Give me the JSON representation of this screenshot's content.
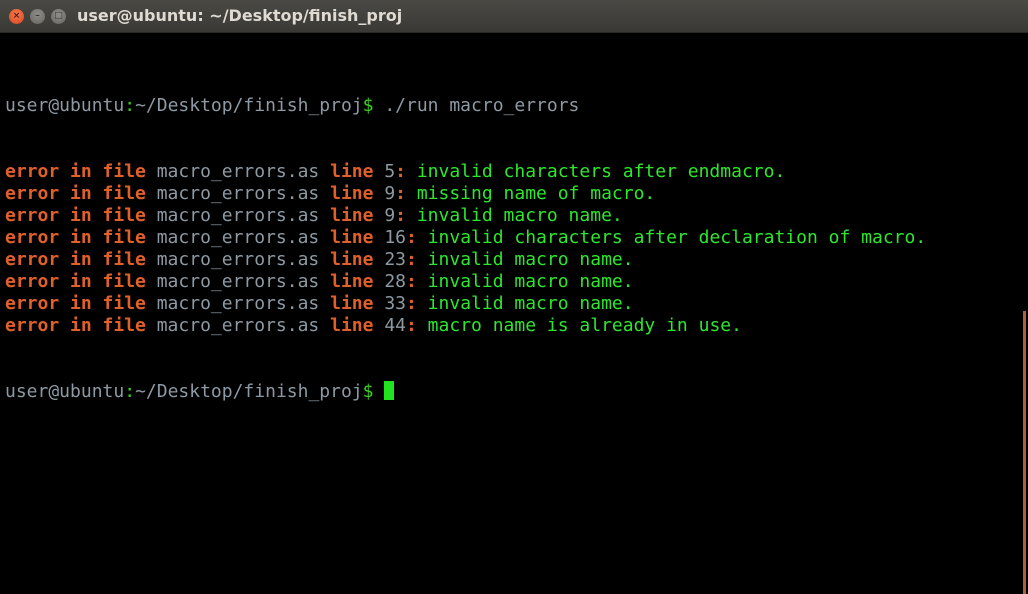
{
  "window": {
    "title": "user@ubuntu: ~/Desktop/finish_proj",
    "close_glyph": "×",
    "min_glyph": "–",
    "max_glyph": "□"
  },
  "colors": {
    "error": "#e0602a",
    "message": "#2ee62e",
    "path": "#8d9aa3",
    "cursor": "#1fe41f",
    "scrollbar": "#b0603e"
  },
  "prompt": {
    "user_host": "user@ubuntu",
    "colon": ":",
    "path": "~/Desktop/finish_proj",
    "dollar": "$",
    "command": " ./run macro_errors"
  },
  "errors": [
    {
      "prefix": "error in file ",
      "file": "macro_errors.as",
      "line_word": " line ",
      "num": "5",
      "colon": ":",
      "msg": " invalid characters after endmacro."
    },
    {
      "prefix": "error in file ",
      "file": "macro_errors.as",
      "line_word": " line ",
      "num": "9",
      "colon": ":",
      "msg": " missing name of macro."
    },
    {
      "prefix": "error in file ",
      "file": "macro_errors.as",
      "line_word": " line ",
      "num": "9",
      "colon": ":",
      "msg": " invalid macro name."
    },
    {
      "prefix": "error in file ",
      "file": "macro_errors.as",
      "line_word": " line ",
      "num": "16",
      "colon": ":",
      "msg": " invalid characters after declaration of macro."
    },
    {
      "prefix": "error in file ",
      "file": "macro_errors.as",
      "line_word": " line ",
      "num": "23",
      "colon": ":",
      "msg": " invalid macro name."
    },
    {
      "prefix": "error in file ",
      "file": "macro_errors.as",
      "line_word": " line ",
      "num": "28",
      "colon": ":",
      "msg": " invalid macro name."
    },
    {
      "prefix": "error in file ",
      "file": "macro_errors.as",
      "line_word": " line ",
      "num": "33",
      "colon": ":",
      "msg": " invalid macro name."
    },
    {
      "prefix": "error in file ",
      "file": "macro_errors.as",
      "line_word": " line ",
      "num": "44",
      "colon": ":",
      "msg": " macro name is already in use."
    }
  ]
}
